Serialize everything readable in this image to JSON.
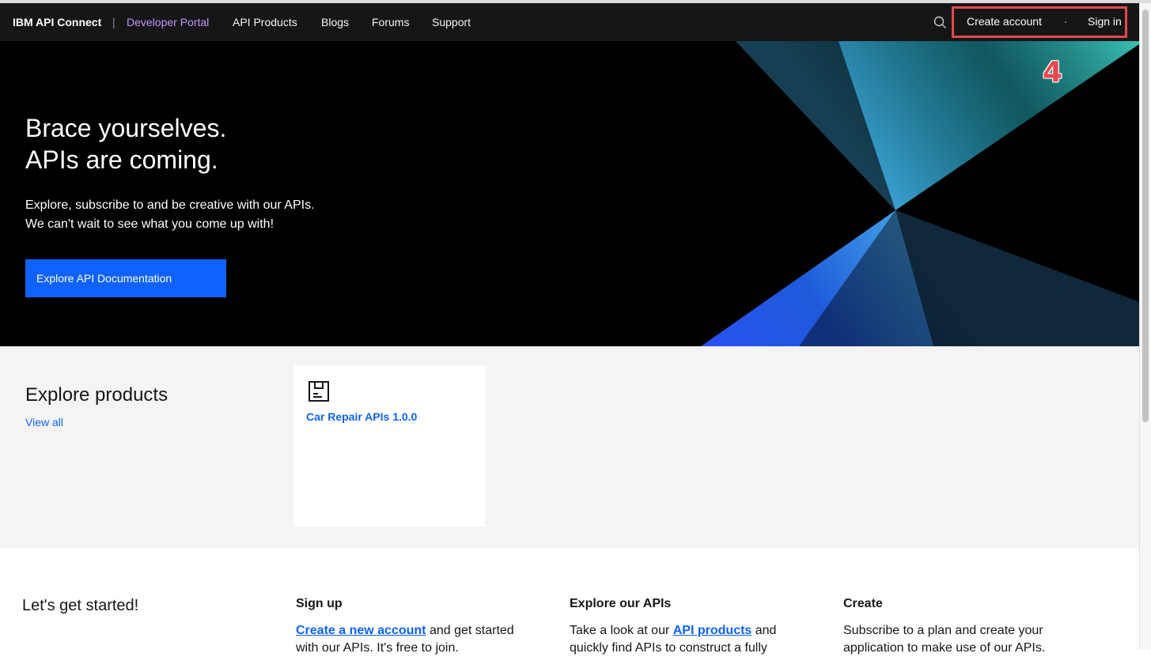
{
  "nav": {
    "brand": "IBM API Connect",
    "separator": "|",
    "portal": "Developer Portal",
    "links": [
      "API Products",
      "Blogs",
      "Forums",
      "Support"
    ],
    "create_account": "Create account",
    "sign_in": "Sign in",
    "search_icon": "search-icon"
  },
  "annotation": {
    "step": "4",
    "color": "#e5484d"
  },
  "hero": {
    "title_line1": "Brace yourselves.",
    "title_line2": "APIs are coming.",
    "subtitle_line1": "Explore, subscribe to and be creative with our APIs.",
    "subtitle_line2": "We can't wait to see what you come up with!",
    "button": "Explore API Documentation"
  },
  "products": {
    "title": "Explore products",
    "view_all": "View all",
    "items": [
      {
        "name": "Car Repair APIs 1.0.0",
        "icon": "product-icon"
      }
    ]
  },
  "get_started": {
    "title": "Let's get started!",
    "columns": [
      {
        "title": "Sign up",
        "link": "Create a new account",
        "text": " and get started with our APIs. It's free to join."
      },
      {
        "title": "Explore our APIs",
        "pre": "Take a look at our ",
        "link": "API products",
        "text": " and quickly find APIs to construct a fully"
      },
      {
        "title": "Create",
        "text": "Subscribe to a plan and create your application to make use of our APIs."
      }
    ]
  },
  "colors": {
    "nav_bg": "#161616",
    "portal": "#be95ff",
    "primary": "#0f62fe",
    "hero_bg": "#000000",
    "section_bg": "#f4f4f4",
    "highlight": "#e5484d"
  }
}
